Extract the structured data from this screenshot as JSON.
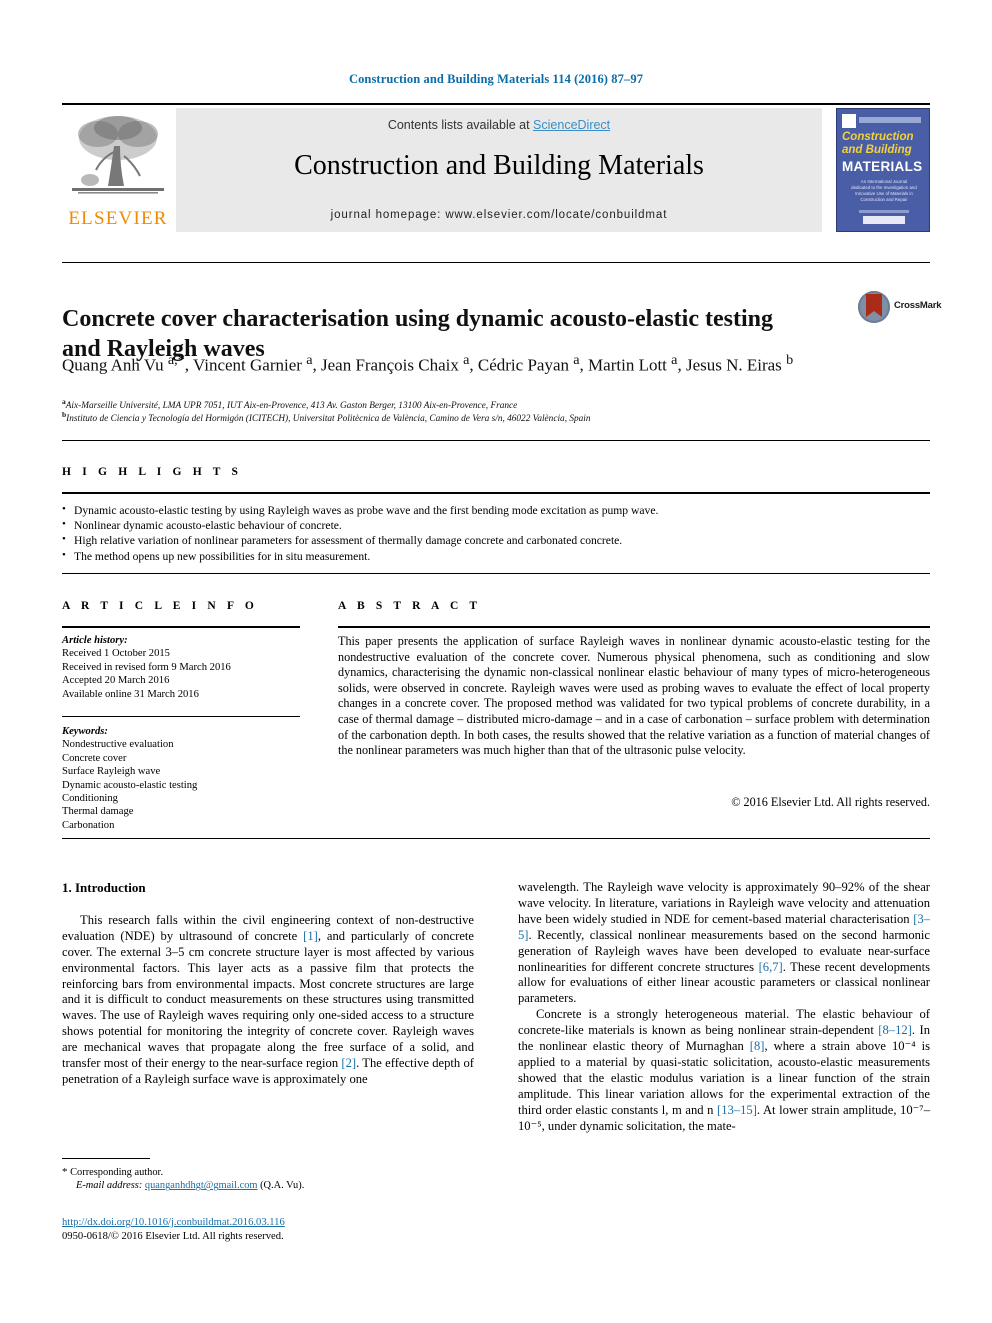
{
  "running_head": "Construction and Building Materials 114 (2016) 87–97",
  "masthead": {
    "publisher_name": "ELSEVIER",
    "contents_prefix": "Contents lists available at ",
    "sciencedirect": "ScienceDirect",
    "journal_title": "Construction and Building Materials",
    "homepage": "journal homepage: www.elsevier.com/locate/conbuildmat",
    "cover": {
      "line1": "Construction",
      "line2": "and Building",
      "line3": "MATERIALS",
      "subtext": "An International Journal dedicated to the Investigation and Innovative Use of Materials in Construction and Repair"
    }
  },
  "article": {
    "title": "Concrete cover characterisation using dynamic acousto-elastic testing and Rayleigh waves",
    "crossmark_label": "CrossMark",
    "authors_html": "Quang Anh Vu <sup>a,*</sup>, Vincent Garnier <sup>a</sup>, Jean François Chaix <sup>a</sup>, Cédric Payan <sup>a</sup>, Martin Lott <sup>a</sup>, Jesus N. Eiras <sup>b</sup>",
    "affiliation_a": "Aix-Marseille Université, LMA UPR 7051, IUT Aix-en-Provence, 413 Av. Gaston Berger, 13100 Aix-en-Provence, France",
    "affiliation_b": "Instituto de Ciencia y Tecnología del Hormigón (ICITECH), Universitat Politècnica de València, Camino de Vera s/n, 46022 València, Spain",
    "affiliation_a_mark": "a",
    "affiliation_b_mark": "b"
  },
  "highlights": {
    "label": "H I G H L I G H T S",
    "items": [
      "Dynamic acousto-elastic testing by using Rayleigh waves as probe wave and the first bending mode excitation as pump wave.",
      "Nonlinear dynamic acousto-elastic behaviour of concrete.",
      "High relative variation of nonlinear parameters for assessment of thermally damage concrete and carbonated concrete.",
      "The method opens up new possibilities for in situ measurement."
    ]
  },
  "article_info": {
    "label": "A R T I C L E    I N F O",
    "history_head": "Article history:",
    "history": [
      "Received 1 October 2015",
      "Received in revised form 9 March 2016",
      "Accepted 20 March 2016",
      "Available online 31 March 2016"
    ],
    "keywords_head": "Keywords:",
    "keywords": [
      "Nondestructive evaluation",
      "Concrete cover",
      "Surface Rayleigh wave",
      "Dynamic acousto-elastic testing",
      "Conditioning",
      "Thermal damage",
      "Carbonation"
    ]
  },
  "abstract": {
    "label": "A B S T R A C T",
    "text": "This paper presents the application of surface Rayleigh waves in nonlinear dynamic acousto-elastic testing for the nondestructive evaluation of the concrete cover. Numerous physical phenomena, such as conditioning and slow dynamics, characterising the dynamic non-classical nonlinear elastic behaviour of many types of micro-heterogeneous solids, were observed in concrete. Rayleigh waves were used as probing waves to evaluate the effect of local property changes in a concrete cover. The proposed method was validated for two typical problems of concrete durability, in a case of thermal damage – distributed micro-damage – and in a case of carbonation – surface problem with determination of the carbonation depth. In both cases, the results showed that the relative variation as a function of material changes of the nonlinear parameters was much higher than that of the ultrasonic pulse velocity.",
    "copyright": "© 2016 Elsevier Ltd. All rights reserved."
  },
  "body": {
    "section_heading": "1. Introduction",
    "left_paragraph_1": "This research falls within the civil engineering context of non-destructive evaluation (NDE) by ultrasound of concrete [1], and particularly of concrete cover. The external 3–5 cm concrete structure layer is most affected by various environmental factors. This layer acts as a passive film that protects the reinforcing bars from environmental impacts. Most concrete structures are large and it is difficult to conduct measurements on these structures using transmitted waves. The use of Rayleigh waves requiring only one-sided access to a structure shows potential for monitoring the integrity of concrete cover. Rayleigh waves are mechanical waves that propagate along the free surface of a solid, and transfer most of their energy to the near-surface region [2]. The effective depth of penetration of a Rayleigh surface wave is approximately one",
    "right_paragraph_1": "wavelength. The Rayleigh wave velocity is approximately 90–92% of the shear wave velocity. In literature, variations in Rayleigh wave velocity and attenuation have been widely studied in NDE for cement-based material characterisation [3–5]. Recently, classical nonlinear measurements based on the second harmonic generation of Rayleigh waves have been developed to evaluate near-surface nonlinearities for different concrete structures [6,7]. These recent developments allow for evaluations of either linear acoustic parameters or classical nonlinear parameters.",
    "right_paragraph_2": "Concrete is a strongly heterogeneous material. The elastic behaviour of concrete-like materials is known as being nonlinear strain-dependent [8–12]. In the nonlinear elastic theory of Murnaghan [8], where a strain above 10⁻⁴ is applied to a material by quasi-static solicitation, acousto-elastic measurements showed that the elastic modulus variation is a linear function of the strain amplitude. This linear variation allows for the experimental extraction of the third order elastic constants l, m and n [13–15]. At lower strain amplitude, 10⁻⁷–10⁻⁵, under dynamic solicitation, the mate-"
  },
  "footnote": {
    "corresponding": "Corresponding author.",
    "email_label": "E-mail address:",
    "email": "quanganhdhgt@gmail.com",
    "email_owner": "(Q.A. Vu).",
    "doi": "http://dx.doi.org/10.1016/j.conbuildmat.2016.03.116",
    "issn": "0950-0618/© 2016 Elsevier Ltd. All rights reserved."
  },
  "colors": {
    "link_blue": "#1a6fa8",
    "sciencedirect_blue": "#3c8dc5",
    "elsevier_orange": "#f08a00",
    "cover_blue": "#4a5ea8",
    "crossmark_red": "#a92b18"
  }
}
